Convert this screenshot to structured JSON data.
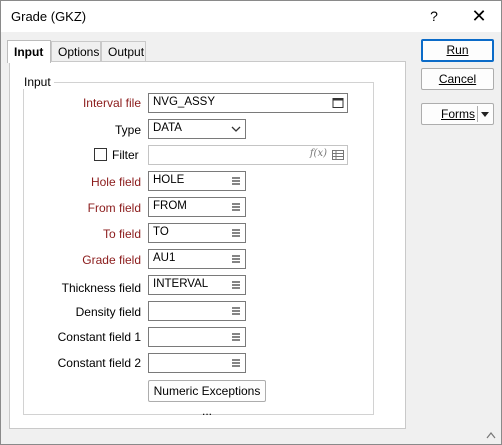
{
  "window": {
    "title": "Grade (GKZ)"
  },
  "titlebar": {
    "help_label": "?",
    "close_label": "✕"
  },
  "tabs": [
    {
      "label": "Input"
    },
    {
      "label": "Options"
    },
    {
      "label": "Output"
    }
  ],
  "group": {
    "label": "Input"
  },
  "form": {
    "interval_file": {
      "label": "Interval file",
      "value": "NVG_ASSY"
    },
    "type": {
      "label": "Type",
      "value": "DATA"
    },
    "filter": {
      "label": "Filter",
      "value": "",
      "fx_label": "f(x)"
    },
    "hole_field": {
      "label": "Hole field",
      "value": "HOLE"
    },
    "from_field": {
      "label": "From field",
      "value": "FROM"
    },
    "to_field": {
      "label": "To field",
      "value": "TO"
    },
    "grade_field": {
      "label": "Grade field",
      "value": "AU1"
    },
    "thickness_field": {
      "label": "Thickness field",
      "value": "INTERVAL"
    },
    "density_field": {
      "label": "Density field",
      "value": ""
    },
    "constant_field_1": {
      "label": "Constant field 1",
      "value": ""
    },
    "constant_field_2": {
      "label": "Constant field 2",
      "value": ""
    },
    "numeric_exceptions_label": "Numeric Exceptions ..."
  },
  "actions": {
    "run_label": "Run",
    "cancel_label": "Cancel",
    "forms_label": "Forms"
  },
  "colors": {
    "required_label": "#8b1b1b",
    "primary_border": "#0b6bc8"
  }
}
